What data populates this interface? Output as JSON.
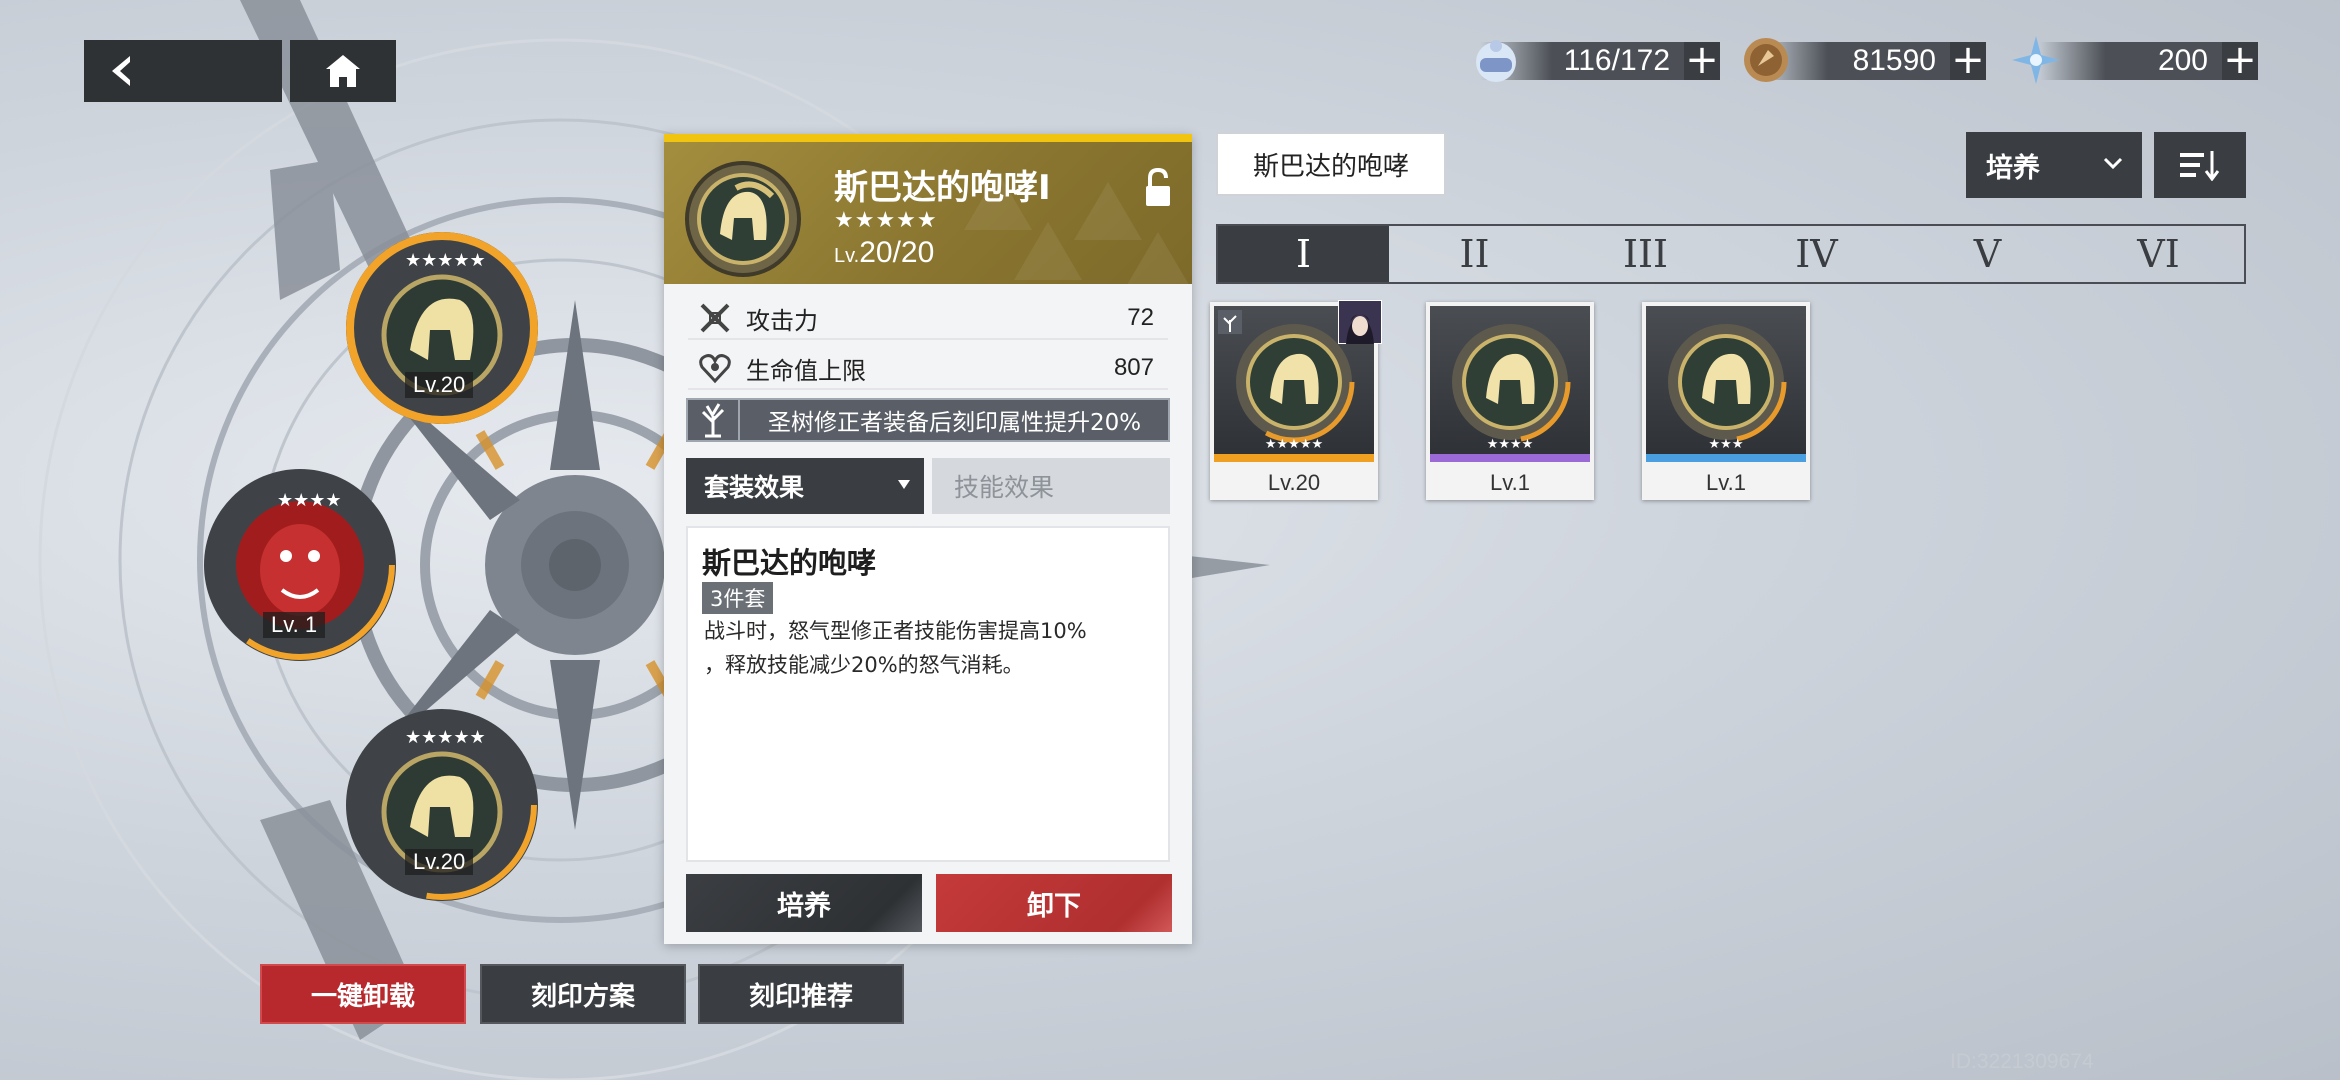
{
  "nav": {
    "back_label": "",
    "home_label": ""
  },
  "currencies": [
    {
      "icon": "stamina-icon",
      "value": "116/172"
    },
    {
      "icon": "coin-icon",
      "value": "81590"
    },
    {
      "icon": "crystal-icon",
      "value": "200"
    }
  ],
  "wheel_slots": [
    {
      "stars": "★★★★★",
      "level": "Lv.20",
      "emblem": "spartan-helmet-icon"
    },
    {
      "stars": "★★★★",
      "level": "Lv. 1",
      "emblem": "oni-mask-icon"
    },
    {
      "stars": "★★★★★",
      "level": "Lv.20",
      "emblem": "spartan-helmet-icon"
    }
  ],
  "panel": {
    "title": "斯巴达的咆哮I",
    "stars": "★★★★★",
    "level_prefix": "Lv.",
    "level": "20/20",
    "stats": [
      {
        "name": "攻击力",
        "value": "72",
        "icon": "attack-icon"
      },
      {
        "name": "生命值上限",
        "value": "807",
        "icon": "health-icon"
      }
    ],
    "bonus": "圣树修正者装备后刻印属性提升20%",
    "tab_set": "套装效果",
    "tab_skill": "技能效果",
    "desc_title": "斯巴达的咆哮",
    "desc_badge": "3件套",
    "desc_line1": "战斗时，怒气型修正者技能伤害提高10%",
    "desc_line2": "，释放技能减少20%的怒气消耗。",
    "btn_train": "培养",
    "btn_unequip": "卸下"
  },
  "right": {
    "set_name": "斯巴达的咆哮",
    "filter": "培养",
    "slot_tabs": [
      "I",
      "II",
      "III",
      "IV",
      "V",
      "VI"
    ],
    "active_tab": 0,
    "cards": [
      {
        "stars": "★★★★★",
        "level": "Lv.20",
        "stripe": "#f0a020"
      },
      {
        "stars": "★★★★",
        "level": "Lv.1",
        "stripe": "#9b6ad6"
      },
      {
        "stars": "★★★",
        "level": "Lv.1",
        "stripe": "#4a9fe0"
      }
    ]
  },
  "bottom": {
    "unload_all": "一键卸载",
    "plan": "刻印方案",
    "recommend": "刻印推荐"
  },
  "uid": "ID:3221309674",
  "colors": {
    "accent_gold": "#f1c40f",
    "red": "#b8292d",
    "dark": "#3a3d41"
  }
}
